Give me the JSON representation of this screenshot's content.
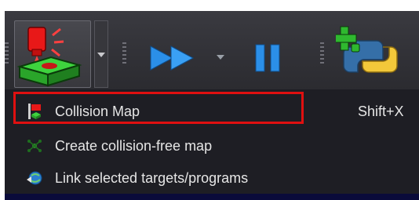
{
  "toolbar": {
    "collision_button_icon": "collision-map-icon",
    "dropdown_icon": "chevron-down-icon",
    "run_icon": "fast-forward-icon",
    "pause_icon": "pause-icon",
    "python_icon": "python-add-icon"
  },
  "menu": {
    "items": [
      {
        "label": "Collision Map",
        "shortcut": "Shift+X",
        "icon": "collision-map-icon",
        "highlighted": true
      },
      {
        "label": "Create collision-free map",
        "shortcut": "",
        "icon": "collision-free-map-icon"
      },
      {
        "label": "Link selected targets/programs",
        "shortcut": "",
        "icon": "link-targets-icon"
      }
    ]
  },
  "colors": {
    "highlight_border": "#e01010",
    "menu_background": "#1e1e24",
    "text": "#e6e6e6",
    "accent_blue": "#2b8fe8"
  }
}
